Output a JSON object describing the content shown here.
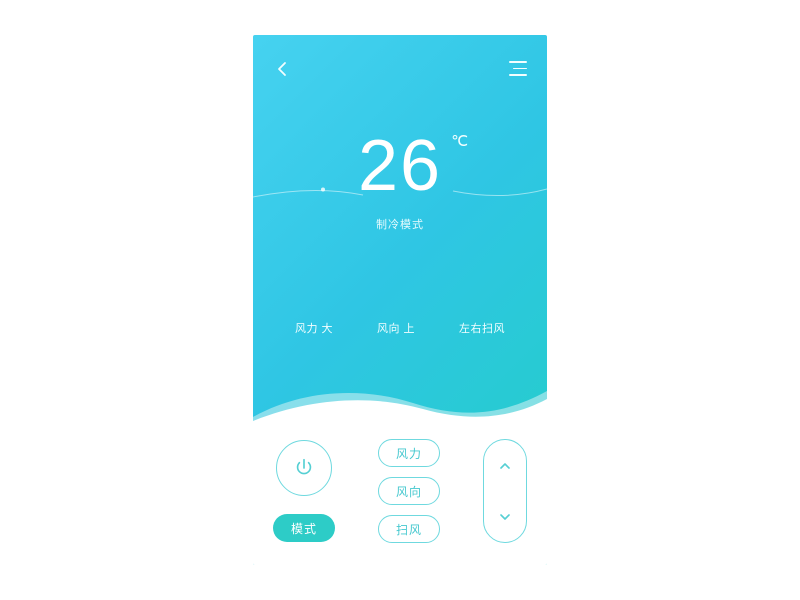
{
  "temperature": {
    "value": "26",
    "unit": "℃",
    "mode_label": "制冷模式"
  },
  "status": {
    "fan": "风力 大",
    "direction": "风向 上",
    "swing": "左右扫风"
  },
  "controls": {
    "mode": "模式",
    "fan": "风力",
    "direction": "风向",
    "swing": "扫风"
  },
  "colors": {
    "accent": "#2dccc7",
    "outline": "#6fd9df"
  }
}
